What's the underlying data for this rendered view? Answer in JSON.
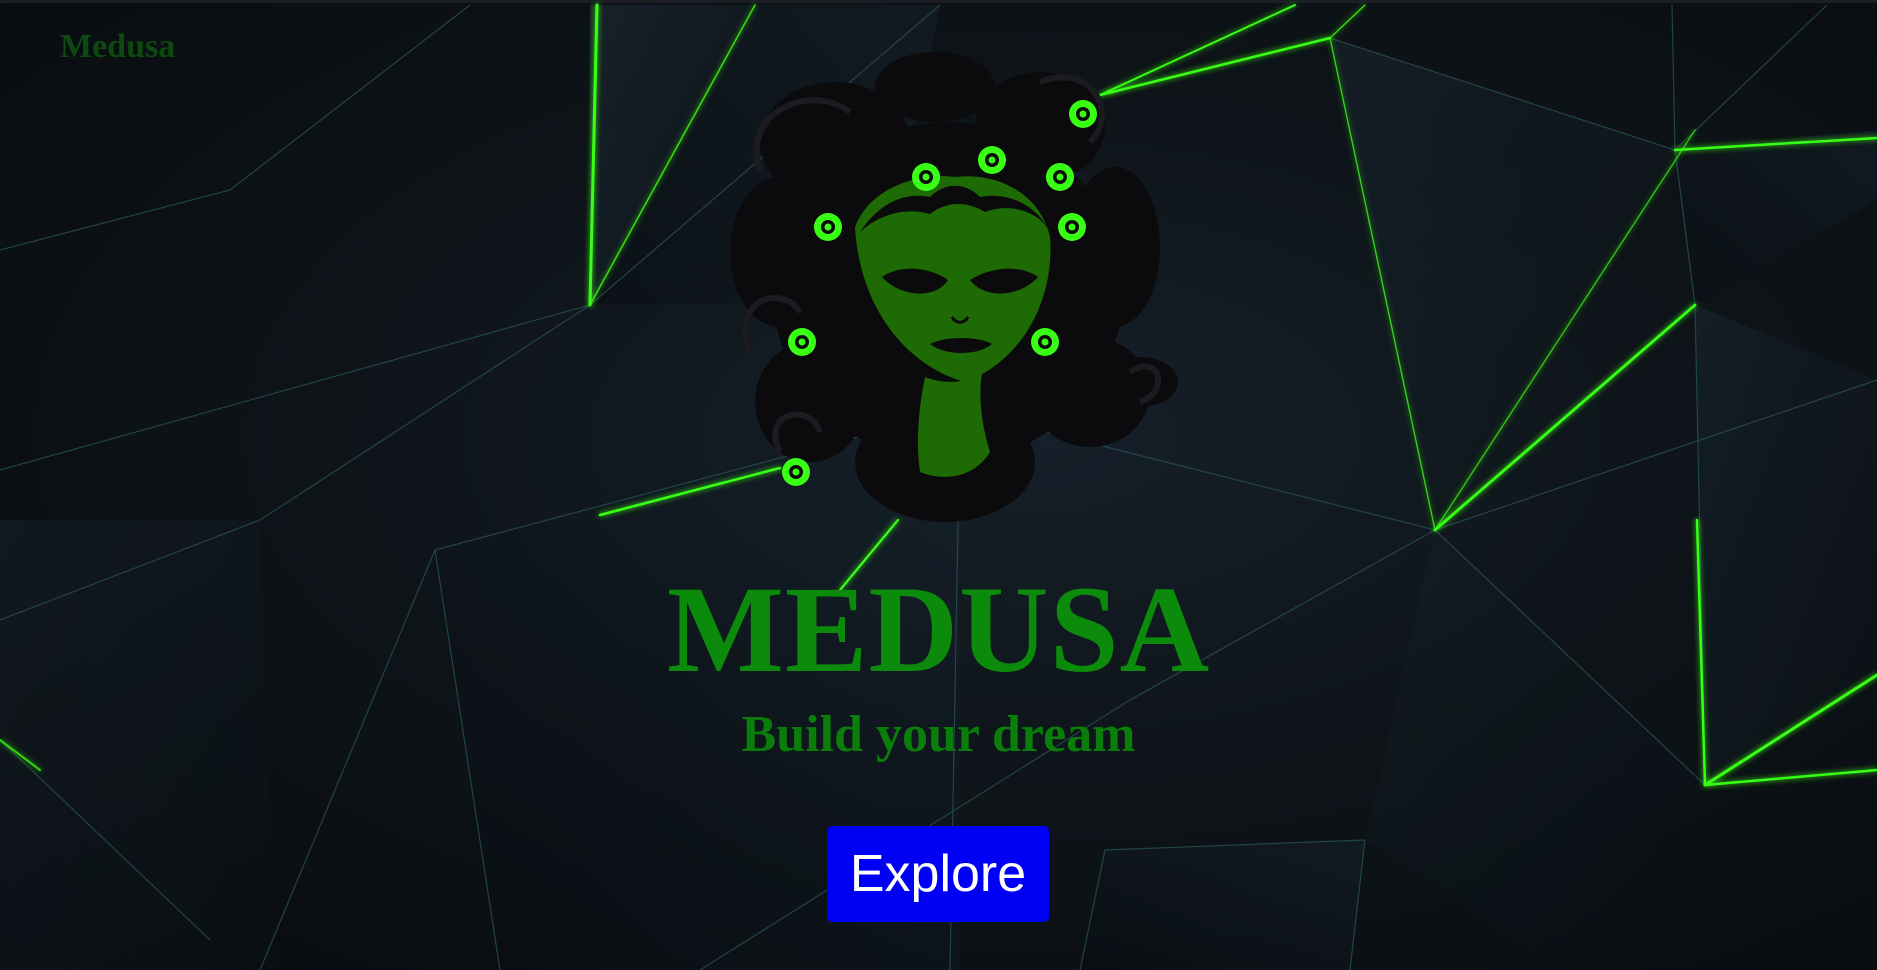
{
  "brand": {
    "name": "Medusa"
  },
  "hero": {
    "logo_icon": "medusa-head-icon",
    "title": "MEDUSA",
    "subtitle": "Build your dream",
    "cta_label": "Explore"
  },
  "colors": {
    "background": "#0c0f12",
    "accent_green": "#0b8a0b",
    "neon_green": "#39ff14",
    "button_blue": "#0000f5",
    "button_text": "#ffffff",
    "brand_text": "#0d4a10"
  }
}
